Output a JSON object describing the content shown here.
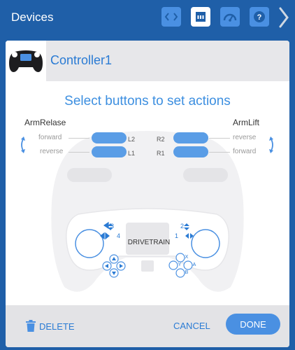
{
  "topbar": {
    "title": "Devices",
    "icons": [
      "code-brackets-icon",
      "device-port-icon",
      "dashboard-gauge-icon",
      "help-icon",
      "chevron-right-icon"
    ]
  },
  "device": {
    "name": "Controller1",
    "icon": "gamepad-icon"
  },
  "main": {
    "heading": "Select buttons to set actions",
    "left_group": {
      "title": "ArmRelase",
      "forward": "forward",
      "reverse": "reverse",
      "top_label": "L2",
      "bottom_label": "L1"
    },
    "right_group": {
      "title": "ArmLift",
      "top_action": "reverse",
      "bottom_action": "forward",
      "top_label": "R2",
      "bottom_label": "R1"
    },
    "pad": {
      "drivetrain": "DRIVETRAIN",
      "axis_3": "3",
      "axis_4": "4",
      "axis_2": "2",
      "axis_1": "1",
      "x": "X",
      "y": "Y",
      "a": "A",
      "b": "B"
    }
  },
  "footer": {
    "delete": "DELETE",
    "cancel": "CANCEL",
    "done": "DONE"
  },
  "colors": {
    "topbar": "#1f5fa8",
    "accent": "#4a90e2",
    "text_blue": "#2a7bd4"
  }
}
